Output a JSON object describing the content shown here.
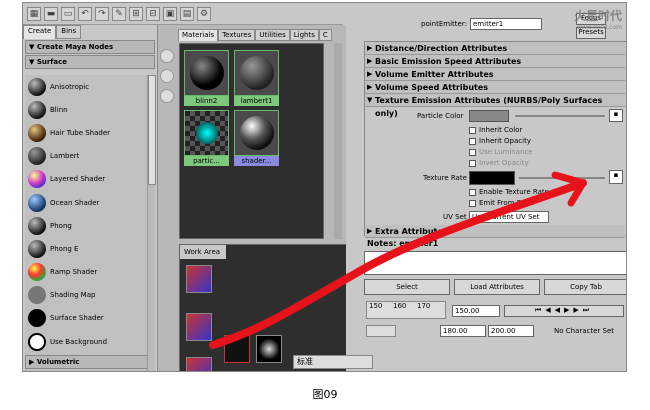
{
  "hypershade": {
    "tabs": [
      "Create",
      "Bins"
    ],
    "create_label": "Create Maya Nodes",
    "section": "Surface",
    "next_section": "Volumetric",
    "nodes": [
      "Anisotropic",
      "Blinn",
      "Hair Tube Shader",
      "Lambert",
      "Layered Shader",
      "Ocean Shader",
      "Phong",
      "Phong E",
      "Ramp Shader",
      "Shading Map",
      "Surface Shader",
      "Use Background"
    ]
  },
  "middle": {
    "tabs": [
      "Materials",
      "Textures",
      "Utilities",
      "Lights",
      "C"
    ],
    "swatches": [
      {
        "label": "blinn2"
      },
      {
        "label": "lambert1"
      },
      {
        "label": "partic..."
      },
      {
        "label": "shader..."
      }
    ],
    "work_area": "Work Area"
  },
  "editor": {
    "emitter_label": "pointEmitter:",
    "emitter_value": "emitter1",
    "focus": "Focus",
    "presets": "Presets",
    "sections": [
      "Distance/Direction Attributes",
      "Basic Emission Speed Attributes",
      "Volume Emitter Attributes",
      "Volume Speed Attributes",
      "Texture Emission Attributes (NURBS/Poly Surfaces only)"
    ],
    "particle_color": "Particle Color",
    "inherit_color": "Inherit Color",
    "inherit_opacity": "Inherit Opacity",
    "use_luminance": "Use Luminance",
    "invert_opacity": "Invert Opacity",
    "texture_rate": "Texture Rate",
    "enable_texture_rate": "Enable Texture Rate",
    "emit_from_dark": "Emit From Dark",
    "uv_set_label": "UV Set",
    "uv_set_value": "Use Current UV Set",
    "extra": "Extra Attributes",
    "notes": "Notes:  emitter1",
    "buttons": [
      "Select",
      "Load Attributes",
      "Copy Tab"
    ],
    "ticks": [
      "150",
      "160",
      "170"
    ],
    "frame": "150.00",
    "range_start": "180.00",
    "range_end": "200.00",
    "character_set": "No Character Set"
  },
  "taskbar": "标准",
  "watermark": "火星时代",
  "watermark_sub": "www.hxsd.com",
  "caption": "图09"
}
